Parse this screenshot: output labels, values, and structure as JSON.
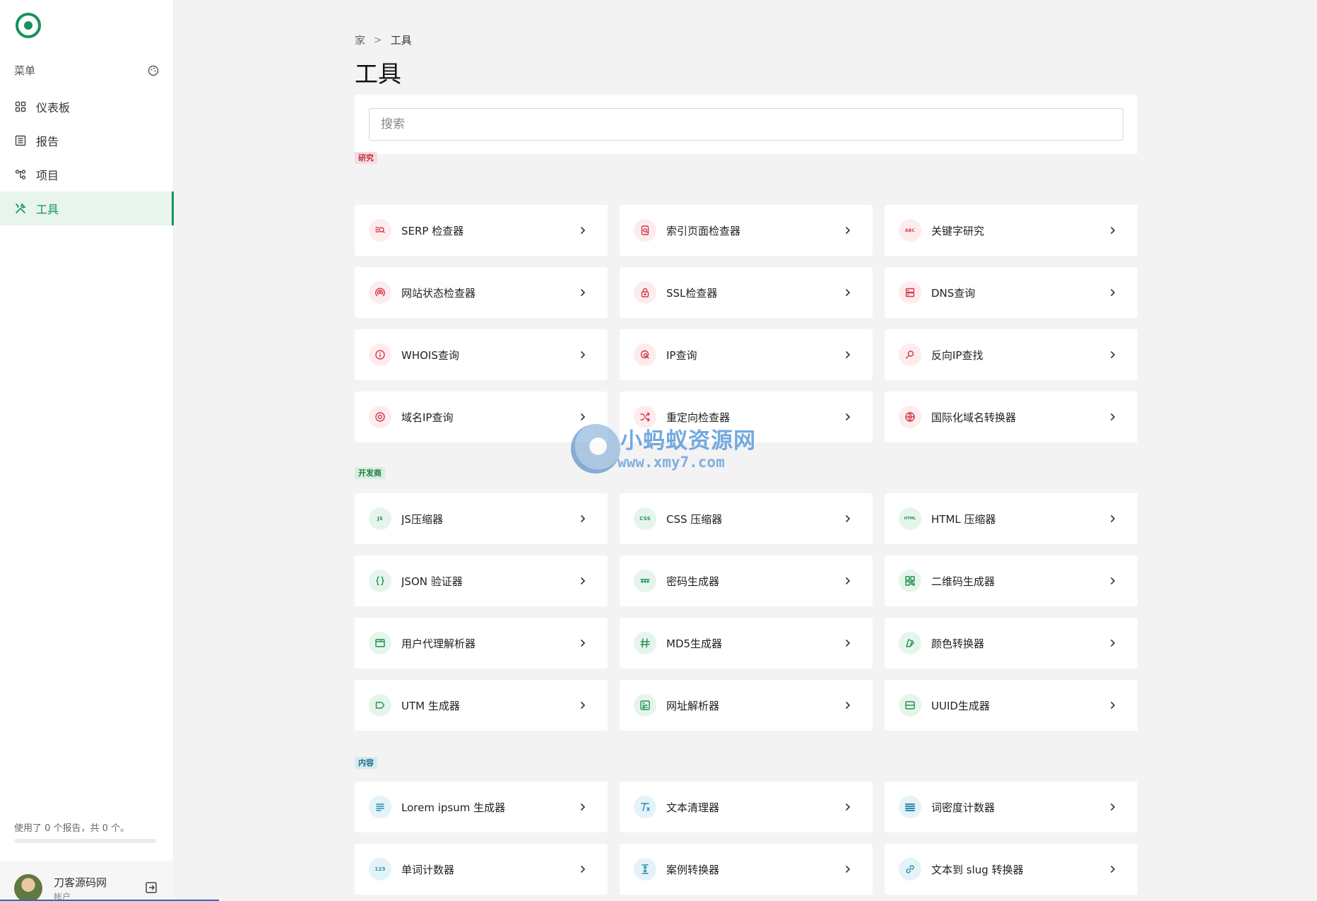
{
  "sidebar": {
    "menu_title": "菜单",
    "items": [
      {
        "label": "仪表板",
        "icon": "grid-icon"
      },
      {
        "label": "报告",
        "icon": "report-icon"
      },
      {
        "label": "项目",
        "icon": "project-icon"
      },
      {
        "label": "工具",
        "icon": "tools-icon",
        "active": true
      }
    ],
    "usage_text": "使用了 0 个报告，共 0 个。",
    "usage_fraction": 0,
    "user_name": "刀客源码网",
    "user_sub": "帐户"
  },
  "breadcrumb": {
    "home": "家",
    "separator": ">",
    "current": "工具"
  },
  "page_title": "工具",
  "search": {
    "placeholder": "搜索",
    "value": ""
  },
  "colors": {
    "accent": "#18925a",
    "research": "#d2384a",
    "developer": "#1f9152",
    "content": "#2a8aa8"
  },
  "categories": {
    "research": {
      "label": "研究",
      "tools": [
        {
          "name": "SERP 检查器",
          "icon": "serp-search-icon"
        },
        {
          "name": "索引页面检查器",
          "icon": "index-page-icon"
        },
        {
          "name": "关键字研究",
          "icon": "abc-keyword-icon"
        },
        {
          "name": "网站状态检查器",
          "icon": "signal-icon"
        },
        {
          "name": "SSL检查器",
          "icon": "lock-icon"
        },
        {
          "name": "DNS查询",
          "icon": "server-icon"
        },
        {
          "name": "WHOIS查询",
          "icon": "info-icon"
        },
        {
          "name": "IP查询",
          "icon": "ip-search-icon"
        },
        {
          "name": "反向IP查找",
          "icon": "magnify-icon"
        },
        {
          "name": "域名IP查询",
          "icon": "location-icon"
        },
        {
          "name": "重定向检查器",
          "icon": "shuffle-icon"
        },
        {
          "name": "国际化域名转换器",
          "icon": "globe-icon"
        }
      ]
    },
    "developer": {
      "label": "开发商",
      "tools": [
        {
          "name": "JS压缩器",
          "icon": "js-icon",
          "badge": "JS"
        },
        {
          "name": "CSS 压缩器",
          "icon": "css-icon",
          "badge": "CSS"
        },
        {
          "name": "HTML 压缩器",
          "icon": "html-icon",
          "badge": "HTML"
        },
        {
          "name": "JSON 验证器",
          "icon": "braces-icon"
        },
        {
          "name": "密码生成器",
          "icon": "password-dots-icon"
        },
        {
          "name": "二维码生成器",
          "icon": "qr-code-icon"
        },
        {
          "name": "用户代理解析器",
          "icon": "browser-window-icon"
        },
        {
          "name": "MD5生成器",
          "icon": "hash-icon"
        },
        {
          "name": "颜色转换器",
          "icon": "color-swatch-icon"
        },
        {
          "name": "UTM 生成器",
          "icon": "tag-icon"
        },
        {
          "name": "网址解析器",
          "icon": "url-parse-icon"
        },
        {
          "name": "UUID生成器",
          "icon": "id-card-icon"
        }
      ]
    },
    "content": {
      "label": "内容",
      "tools": [
        {
          "name": "Lorem ipsum 生成器",
          "icon": "text-lines-icon"
        },
        {
          "name": "文本清理器",
          "icon": "clear-format-icon"
        },
        {
          "name": "词密度计数器",
          "icon": "density-bars-icon"
        },
        {
          "name": "单词计数器",
          "icon": "counter-123-icon",
          "badge": "123"
        },
        {
          "name": "案例转换器",
          "icon": "case-convert-icon"
        },
        {
          "name": "文本到 slug 转换器",
          "icon": "link-icon"
        }
      ]
    }
  },
  "watermark": {
    "title": "小蚂蚁资源网",
    "url": "www.xmy7.com"
  }
}
